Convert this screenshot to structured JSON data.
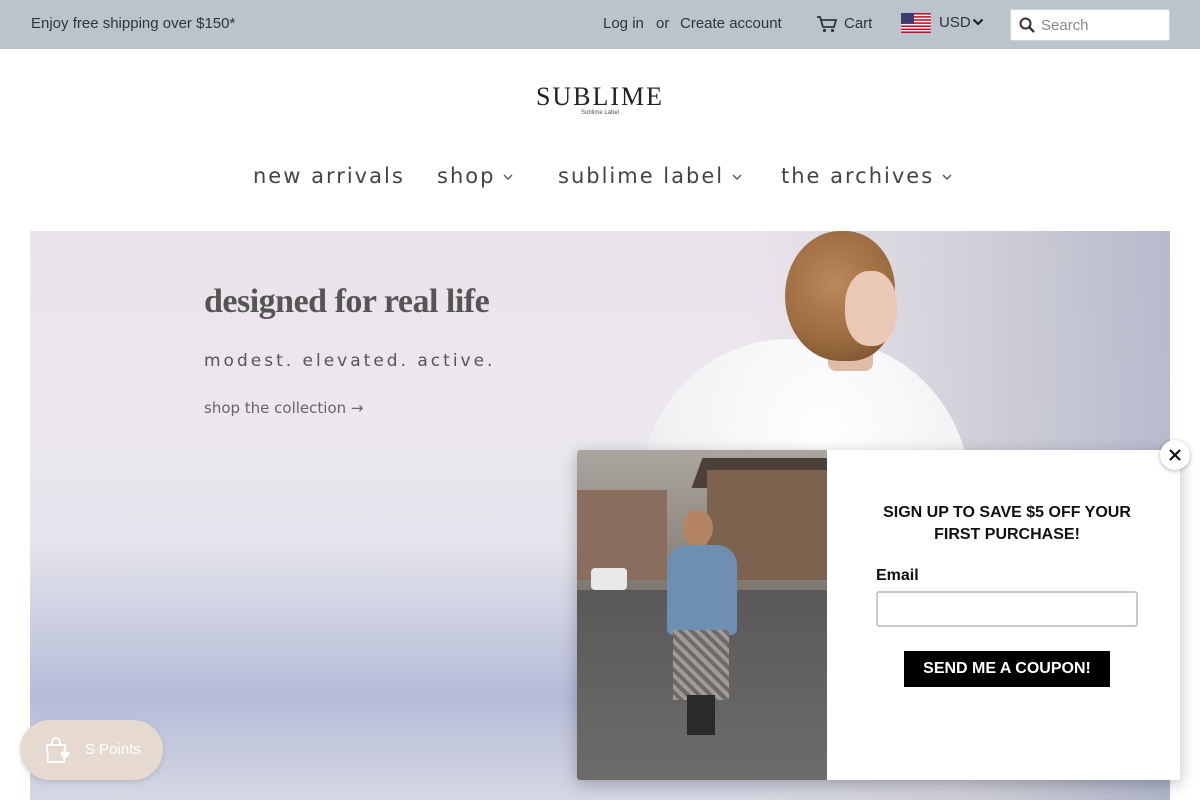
{
  "topbar": {
    "promo": "Enjoy free shipping over $150*",
    "login": "Log in",
    "or": "or",
    "create_account": "Create account",
    "cart_label": "Cart",
    "cart_icon": "cart-icon",
    "currency": "USD",
    "flag_icon": "us-flag-icon",
    "search_placeholder": "Search"
  },
  "logo": {
    "main": "SUBLIME",
    "sub": "Sublime Label"
  },
  "nav": {
    "items": [
      {
        "label": "new arrivals",
        "has_dropdown": false
      },
      {
        "label": "shop",
        "has_dropdown": true
      },
      {
        "label": "sublime label",
        "has_dropdown": true
      },
      {
        "label": "the archives",
        "has_dropdown": true
      }
    ]
  },
  "hero": {
    "headline": "designed for real life",
    "tagline": "modest. elevated. active.",
    "cta": "shop the collection →"
  },
  "points": {
    "label": "S Points",
    "icon": "shopping-bag-heart-icon"
  },
  "popup": {
    "heading": "SIGN UP TO SAVE $5 OFF YOUR FIRST PURCHASE!",
    "email_label": "Email",
    "email_value": "",
    "submit_label": "SEND ME A COUPON!",
    "close_icon": "close-icon"
  },
  "colors": {
    "topbar_bg": "#b9c4cd",
    "popup_button": "#000000",
    "points_widget": "#e6dad0"
  }
}
